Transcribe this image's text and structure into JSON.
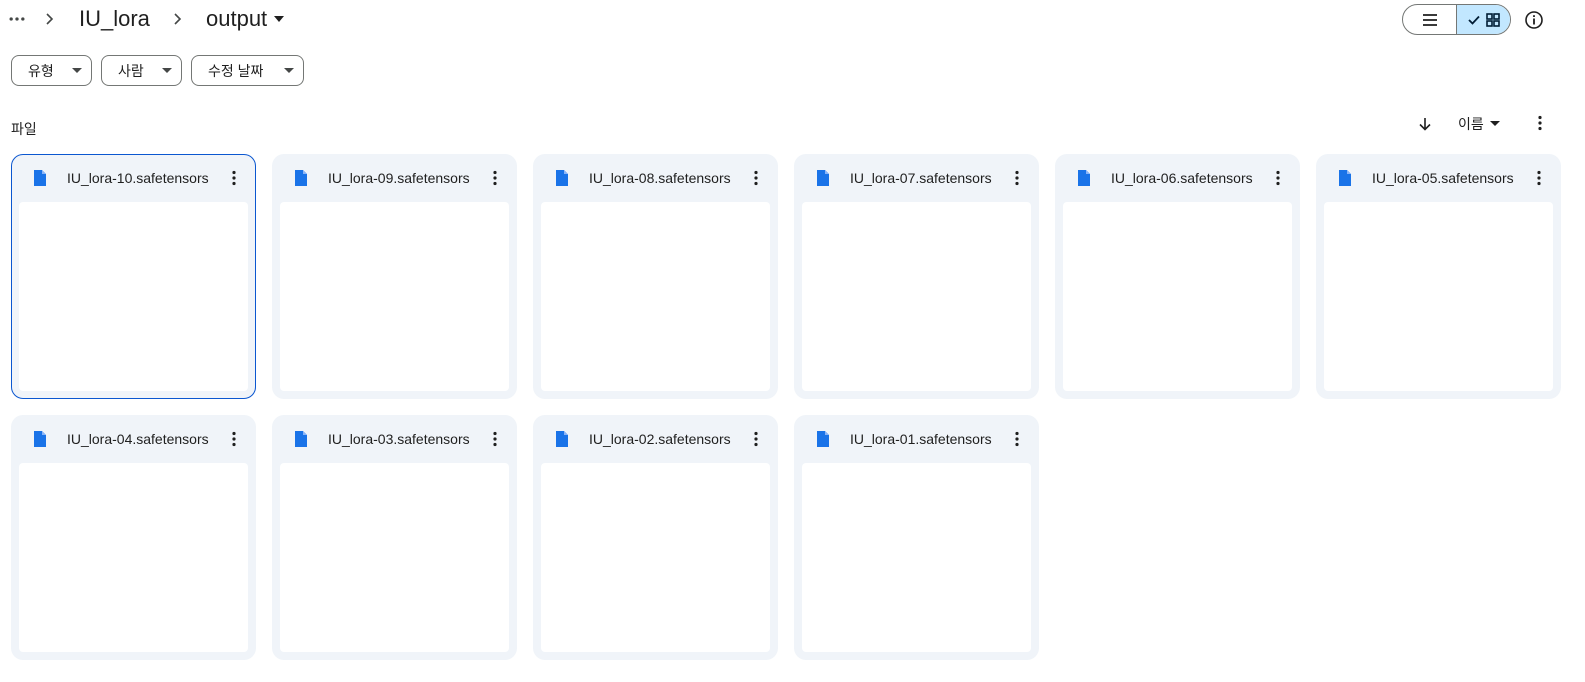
{
  "breadcrumb": {
    "items": [
      "IU_lora",
      "output"
    ]
  },
  "view": {
    "mode": "grid"
  },
  "filters": [
    {
      "label": "유형"
    },
    {
      "label": "사람"
    },
    {
      "label": "수정 날짜"
    }
  ],
  "section": {
    "label": "파일",
    "sort_label": "이름"
  },
  "files": [
    {
      "name": "IU_lora-10.safetensors",
      "selected": true
    },
    {
      "name": "IU_lora-09.safetensors",
      "selected": false
    },
    {
      "name": "IU_lora-08.safetensors",
      "selected": false
    },
    {
      "name": "IU_lora-07.safetensors",
      "selected": false
    },
    {
      "name": "IU_lora-06.safetensors",
      "selected": false
    },
    {
      "name": "IU_lora-05.safetensors",
      "selected": false
    },
    {
      "name": "IU_lora-04.safetensors",
      "selected": false
    },
    {
      "name": "IU_lora-03.safetensors",
      "selected": false
    },
    {
      "name": "IU_lora-02.safetensors",
      "selected": false
    },
    {
      "name": "IU_lora-01.safetensors",
      "selected": false
    }
  ],
  "colors": {
    "accent": "#0b57d0",
    "file_icon": "#1a73e8",
    "card_bg": "#f0f4f9",
    "toggle_active": "#c2e7ff"
  },
  "icons": {
    "breadcrumb_more": "more-horiz-icon",
    "separator": "chevron-right-icon",
    "dropdown": "arrow-drop-down-icon",
    "list_view": "list-view-icon",
    "grid_view": "grid-view-icon",
    "check": "check-icon",
    "info": "info-icon",
    "sort_direction": "arrow-down-icon",
    "more": "more-vert-icon",
    "file": "document-icon"
  }
}
